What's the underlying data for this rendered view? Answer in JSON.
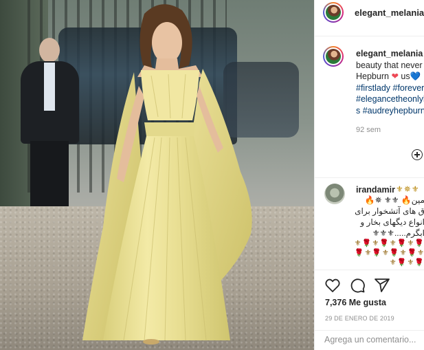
{
  "post": {
    "username": "elegant_melania",
    "photo_alt": "Photo"
  },
  "caption": {
    "username": "elegant_melania",
    "line1_rest": " \"",
    "line2": "beauty that never",
    "line3_word": "Hepburn ",
    "line3_mid": " us",
    "line4": "#firstlady #forever",
    "line5": "#elegancetheonlyb",
    "line6": "s #audreyhepburn",
    "heart_red": "❤",
    "heart_blue": "💙",
    "time_ago": "92 sem"
  },
  "comment": {
    "username": "irandamir",
    "top_emoji": "⚜✵⚜",
    "lines": [
      "مین🔥 ⚜⚜ ✵🔥",
      "ق های آتشخوار برای",
      "انواع دیگهای بخار و",
      "ابگرم.....⚜⚜⚜"
    ],
    "emoji_rows": [
      "🌹⚜🌹⚜🌹⚜🌹⚜",
      "⚜🌹⚜🌹⚜🌹⚜🌹",
      "🌹⚜🌹⚜"
    ]
  },
  "actions": {
    "icons": [
      "heart-icon",
      "comment-icon",
      "share-icon"
    ],
    "likes": "7,376 Me gusta",
    "date": "29 DE ENERO DE 2019"
  },
  "add_comment": {
    "placeholder": "Agrega un comentario..."
  },
  "colors": {
    "link": "#00376b",
    "muted": "#8e8e8e",
    "dress": "#efe59a",
    "border": "#efefef"
  }
}
